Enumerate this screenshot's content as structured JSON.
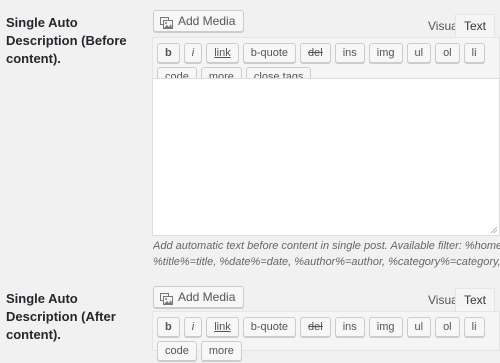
{
  "fields": [
    {
      "label": "Single Auto Description (Before content).",
      "add_media": "Add Media",
      "tabs": [
        "Visual",
        "Text"
      ],
      "active_tab": "Text",
      "toolbar": [
        "b",
        "i",
        "link",
        "b-quote",
        "del",
        "ins",
        "img",
        "ul",
        "ol",
        "li",
        "code",
        "more",
        "close tags"
      ],
      "value": "",
      "help_line1": "Add automatic text before content in single post. Available filter: %homeurl%=hom",
      "help_line2": "%title%=title, %date%=date, %author%=author, %category%=category, %tag%=t"
    },
    {
      "label": "Single Auto Description (After content).",
      "add_media": "Add Media",
      "tabs": [
        "Visual",
        "Text"
      ],
      "active_tab": "Text",
      "toolbar": [
        "b",
        "i",
        "link",
        "b-quote",
        "del",
        "ins",
        "img",
        "ul",
        "ol",
        "li",
        "code",
        "more"
      ]
    }
  ],
  "icons": {
    "add_media": "media-icon"
  }
}
